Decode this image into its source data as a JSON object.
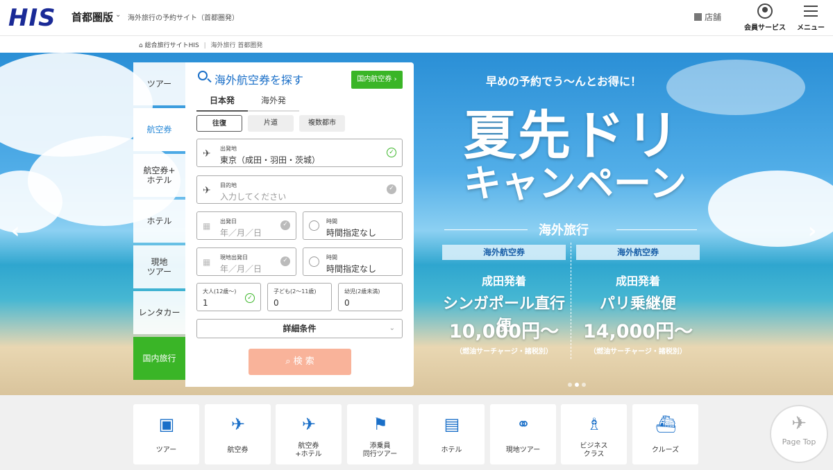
{
  "header": {
    "logo": "HIS",
    "region": "首都圏版",
    "region_chevron": "⌄",
    "site_desc": "海外旅行の予約サイト（首都圏発）",
    "store": "店舗",
    "member": "会員サービス",
    "menu": "メニュー"
  },
  "breadcrumb": {
    "home": "総合旅行サイトHIS",
    "current": "海外旅行 首都圏発"
  },
  "side_tabs": [
    "ツアー",
    "航空券",
    "航空券+\nホテル",
    "ホテル",
    "現地\nツアー",
    "レンタカー",
    "国内旅行"
  ],
  "search_panel": {
    "title": "海外航空券を探す",
    "domestic_button": "国内航空券 ›",
    "departure_tabs": [
      "日本発",
      "海外発"
    ],
    "trip_types": [
      "往復",
      "片道",
      "複数都市"
    ],
    "origin": {
      "label": "出発地",
      "value": "東京（成田・羽田・茨城）"
    },
    "destination": {
      "label": "目的地",
      "placeholder": "入力してください"
    },
    "depart_date": {
      "label": "出発日",
      "placeholder": "年／月／日"
    },
    "depart_time": {
      "label": "時間",
      "value": "時間指定なし"
    },
    "local_date": {
      "label": "現地出発日",
      "placeholder": "年／月／日"
    },
    "local_time": {
      "label": "時間",
      "value": "時間指定なし"
    },
    "adults": {
      "label": "大人(12歳〜)",
      "value": "1"
    },
    "children": {
      "label": "子ども(2〜11歳)",
      "value": "0"
    },
    "infants": {
      "label": "幼児(2歳未満)",
      "value": "0"
    },
    "details": "詳細条件",
    "search_button": "検 索"
  },
  "promo": {
    "subtitle": "早めの予約でう〜んとお得に！",
    "title_line1": "夏先ドリ",
    "title_line2": "キャンペーン",
    "overseas": "海外旅行",
    "deals": [
      {
        "badge": "海外航空券",
        "from": "成田発着",
        "dest": "シンガポール直行便",
        "price": "10,000円〜",
        "note": "（燃油サーチャージ・諸税別）"
      },
      {
        "badge": "海外航空券",
        "from": "成田発着",
        "dest": "パリ乗継便",
        "price": "14,000円〜",
        "note": "（燃油サーチャージ・諸税別）"
      }
    ]
  },
  "categories": [
    {
      "label": "ツアー",
      "icon": "suitcase-icon"
    },
    {
      "label": "航空券",
      "icon": "airplane-icon"
    },
    {
      "label": "航空券\n+ホテル",
      "icon": "plane-bed-icon"
    },
    {
      "label": "添乗員\n同行ツアー",
      "icon": "flag-suitcase-icon"
    },
    {
      "label": "ホテル",
      "icon": "hotel-bed-icon"
    },
    {
      "label": "現地ツアー",
      "icon": "snorkel-icon"
    },
    {
      "label": "ビジネス\nクラス",
      "icon": "business-seat-icon"
    },
    {
      "label": "クルーズ",
      "icon": "ship-icon"
    }
  ],
  "page_top": "Page Top",
  "colors": {
    "brand": "#1a2a96",
    "accent_blue": "#1a6fc8",
    "green": "#3ab527",
    "search_button": "#f9b39a"
  }
}
